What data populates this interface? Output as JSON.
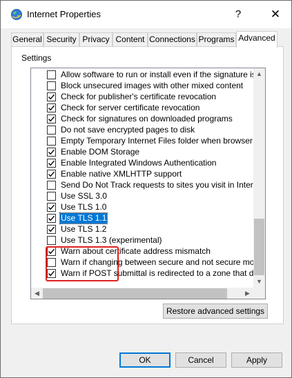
{
  "window": {
    "title": "Internet Properties",
    "help": "?",
    "close": "✕"
  },
  "tabs": [
    {
      "label": "General"
    },
    {
      "label": "Security"
    },
    {
      "label": "Privacy"
    },
    {
      "label": "Content"
    },
    {
      "label": "Connections"
    },
    {
      "label": "Programs"
    },
    {
      "label": "Advanced",
      "active": true
    }
  ],
  "settings_label": "Settings",
  "options": [
    {
      "label": "Allow software to run or install even if the signature is inva",
      "checked": false
    },
    {
      "label": "Block unsecured images with other mixed content",
      "checked": false
    },
    {
      "label": "Check for publisher's certificate revocation",
      "checked": true
    },
    {
      "label": "Check for server certificate revocation",
      "checked": true
    },
    {
      "label": "Check for signatures on downloaded programs",
      "checked": true
    },
    {
      "label": "Do not save encrypted pages to disk",
      "checked": false
    },
    {
      "label": "Empty Temporary Internet Files folder when browser is clo",
      "checked": false
    },
    {
      "label": "Enable DOM Storage",
      "checked": true
    },
    {
      "label": "Enable Integrated Windows Authentication",
      "checked": true
    },
    {
      "label": "Enable native XMLHTTP support",
      "checked": true
    },
    {
      "label": "Send Do Not Track requests to sites you visit in Internet E",
      "checked": false
    },
    {
      "label": "Use SSL 3.0",
      "checked": false
    },
    {
      "label": "Use TLS 1.0",
      "checked": true
    },
    {
      "label": "Use TLS 1.1",
      "checked": true,
      "selected": true
    },
    {
      "label": "Use TLS 1.2",
      "checked": true
    },
    {
      "label": "Use TLS 1.3 (experimental)",
      "checked": false
    },
    {
      "label": "Warn about certificate address mismatch",
      "checked": true
    },
    {
      "label": "Warn if changing between secure and not secure mode",
      "checked": false
    },
    {
      "label": "Warn if POST submittal is redirected to a zone that does n",
      "checked": true
    }
  ],
  "restore_button": "Restore advanced settings",
  "buttons": {
    "ok": "OK",
    "cancel": "Cancel",
    "apply": "Apply"
  },
  "colors": {
    "selection": "#0078d7",
    "highlight_box": "#e02020"
  }
}
